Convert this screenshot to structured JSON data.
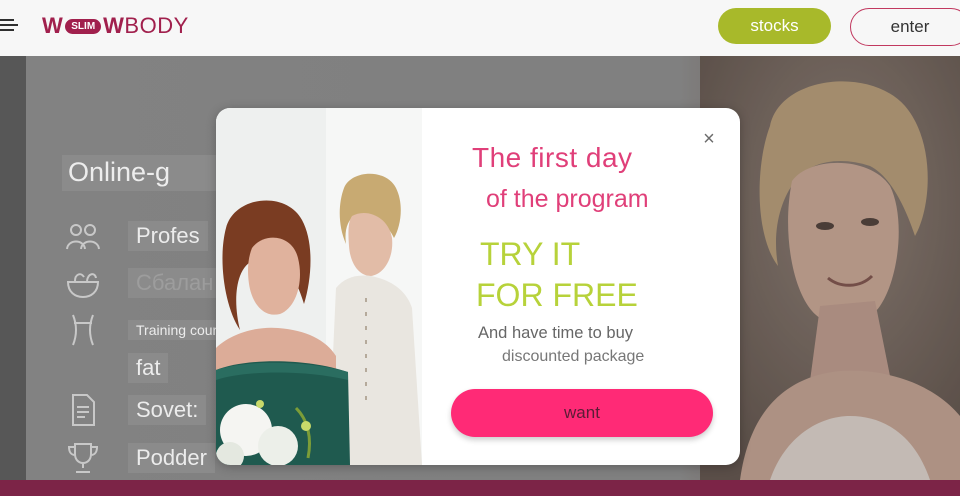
{
  "header": {
    "logo": {
      "w1": "W",
      "slim": "SLIM",
      "w2": "W",
      "body": "BODY"
    },
    "stocks_label": "stocks",
    "enter_label": "enter"
  },
  "background": {
    "heading": "Online-g",
    "items": [
      {
        "label": "Profes",
        "icon": "people-icon"
      },
      {
        "label": "Сбалан",
        "icon": "salad-bowl-icon"
      },
      {
        "label": "Training course",
        "icon": "waist-icon"
      },
      {
        "label": "fat",
        "icon": ""
      },
      {
        "label": "Sovet:",
        "icon": "document-icon"
      },
      {
        "label": "Podder",
        "icon": "trophy-icon"
      }
    ]
  },
  "modal": {
    "title_line1": "The first day",
    "title_line2": "of the program",
    "try_line1": "TRY IT",
    "try_line2": "FOR FREE",
    "sub_line1": "And have time to buy",
    "sub_line2": "discounted package",
    "cta_label": "want",
    "close_symbol": "×"
  },
  "colors": {
    "brand": "#a1204d",
    "accent_green": "#b7d23a",
    "stocks_green": "#a8b92a",
    "title_pink": "#e03f79",
    "cta_pink": "#ff2a76",
    "bottom_bar": "#7c2447"
  }
}
